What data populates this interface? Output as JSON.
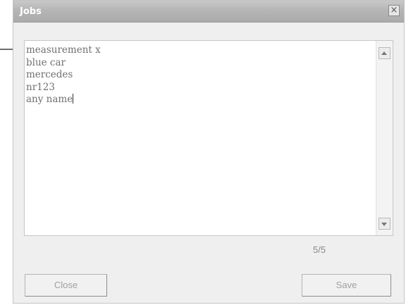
{
  "window": {
    "title": "Jobs",
    "close_glyph": "×"
  },
  "editor": {
    "lines": [
      "measurement x",
      "blue car",
      "mercedes",
      "nr123",
      "any name"
    ]
  },
  "counter": "5/5",
  "buttons": {
    "close_label": "Close",
    "save_label": "Save"
  },
  "icons": {
    "scroll_up": "triangle-up-icon",
    "scroll_down": "triangle-down-icon",
    "window_close": "close-icon"
  }
}
